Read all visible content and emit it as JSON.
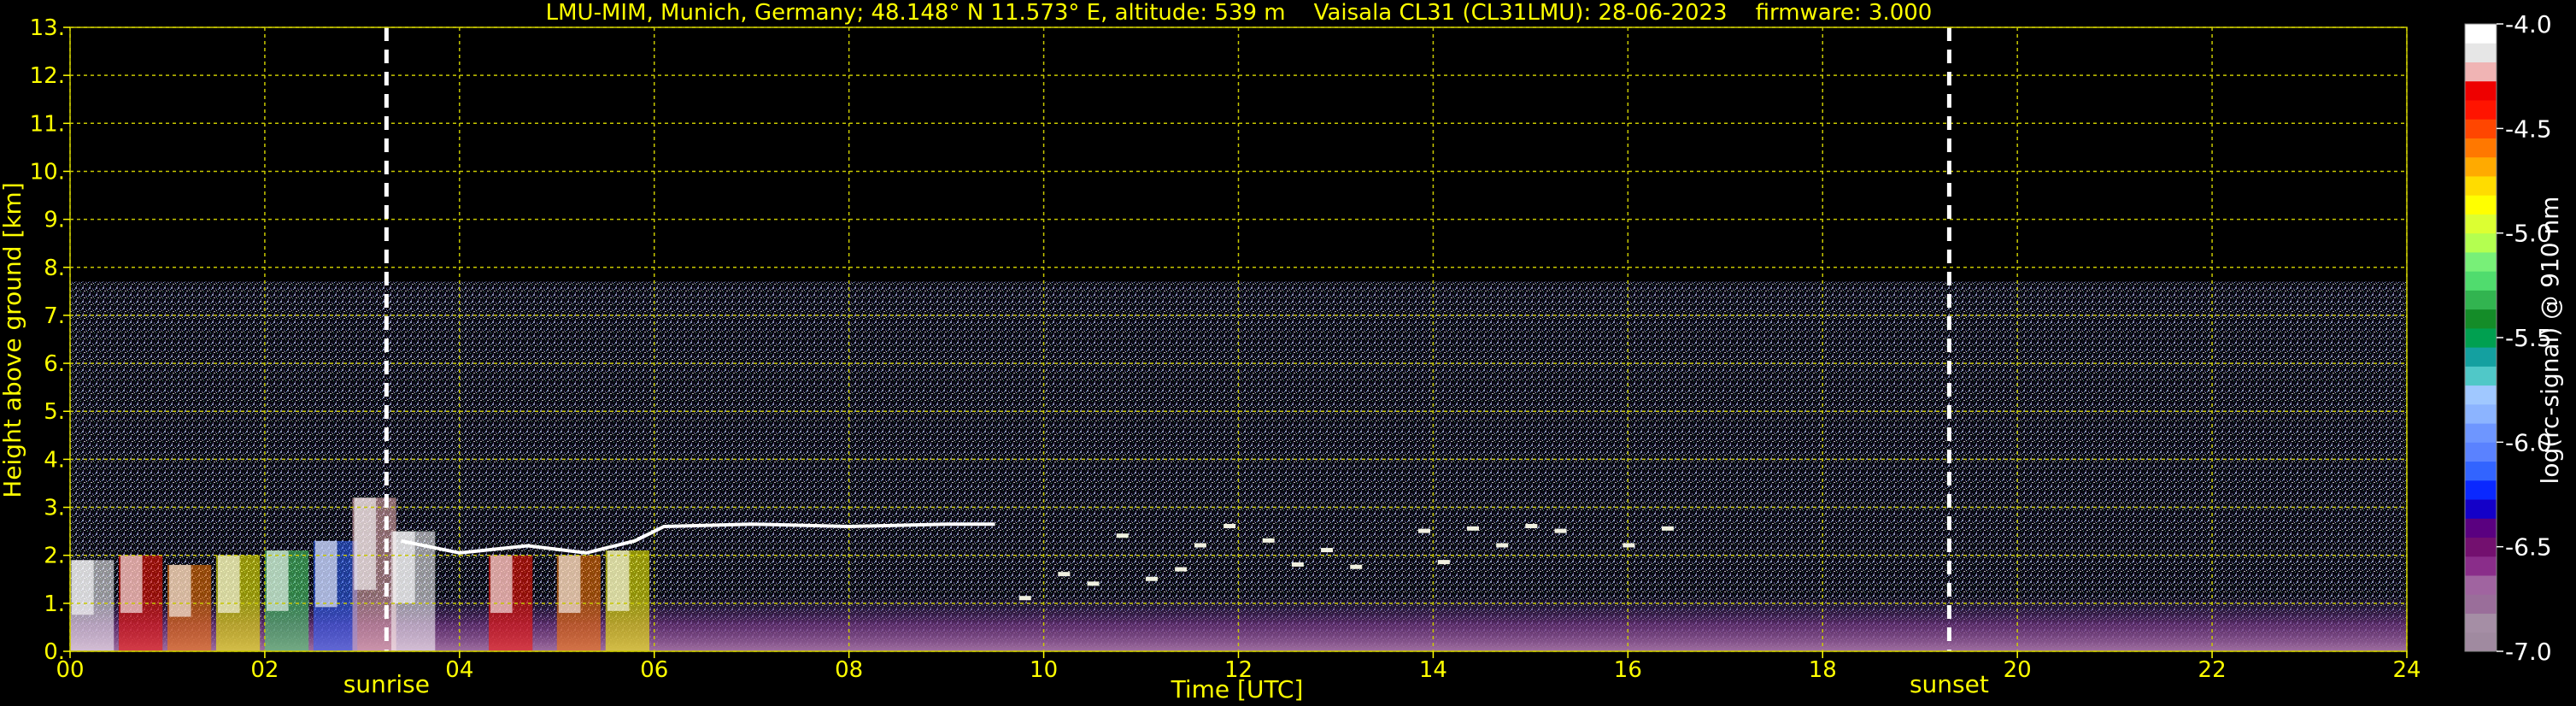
{
  "chart_data": {
    "type": "heatmap",
    "title": "LMU-MIM, Munich, Germany; 48.148° N 11.573° E, altitude: 539 m    Vaisala CL31 (CL31LMU): 28-06-2023    firmware: 3.000",
    "xlabel": "Time [UTC]",
    "ylabel": "Height above ground [km]",
    "xlim": [
      0,
      24
    ],
    "ylim": [
      0,
      13
    ],
    "x_ticks": [
      "00",
      "02",
      "04",
      "06",
      "08",
      "10",
      "12",
      "14",
      "16",
      "18",
      "20",
      "22",
      "24"
    ],
    "y_ticks": [
      "0.",
      "1.",
      "2.",
      "3.",
      "4.",
      "5.",
      "6.",
      "7.",
      "8.",
      "9.",
      "10.",
      "11.",
      "12.",
      "13."
    ],
    "grid": true,
    "data_top_km": 7.7,
    "events": [
      {
        "label": "sunrise",
        "time": 3.25
      },
      {
        "label": "sunset",
        "time": 19.3
      }
    ],
    "colorbar": {
      "label": "log(rc-signal) @ 910 nm",
      "range": [
        -7.0,
        -4.0
      ],
      "ticks": [
        "-7.0",
        "-6.5",
        "-6.0",
        "-5.5",
        "-5.0",
        "-4.5",
        "-4.0"
      ],
      "colors": [
        "#a08aa0",
        "#a58ea5",
        "#9a6e9a",
        "#a064a0",
        "#8a2d8a",
        "#73106f",
        "#5a0080",
        "#1400c8",
        "#0a28ff",
        "#3264ff",
        "#5a82ff",
        "#6e96ff",
        "#8cb4ff",
        "#a0c8ff",
        "#50c8c8",
        "#14a0a0",
        "#00a050",
        "#148c28",
        "#32b450",
        "#50dc6e",
        "#78f078",
        "#b4ff50",
        "#dcff32",
        "#ffff00",
        "#ffdc00",
        "#ffaa00",
        "#ff7800",
        "#ff4600",
        "#ff1400",
        "#ee0000",
        "#f0b4b4",
        "#e6e6e6",
        "#ffffff"
      ]
    },
    "cloud_base_layer": [
      {
        "x": 3.4,
        "y": 2.3
      },
      {
        "x": 4.0,
        "y": 2.05
      },
      {
        "x": 4.7,
        "y": 2.2
      },
      {
        "x": 5.3,
        "y": 2.05
      },
      {
        "x": 5.8,
        "y": 2.3
      },
      {
        "x": 6.1,
        "y": 2.6
      },
      {
        "x": 7.0,
        "y": 2.65
      },
      {
        "x": 8.0,
        "y": 2.6
      },
      {
        "x": 9.0,
        "y": 2.65
      },
      {
        "x": 9.5,
        "y": 2.65
      }
    ],
    "scattered_clouds": [
      {
        "x": 9.8,
        "y": 1.1
      },
      {
        "x": 10.2,
        "y": 1.6
      },
      {
        "x": 10.5,
        "y": 1.4
      },
      {
        "x": 10.8,
        "y": 2.4
      },
      {
        "x": 11.1,
        "y": 1.5
      },
      {
        "x": 11.4,
        "y": 1.7
      },
      {
        "x": 11.6,
        "y": 2.2
      },
      {
        "x": 11.9,
        "y": 2.6
      },
      {
        "x": 12.3,
        "y": 2.3
      },
      {
        "x": 12.6,
        "y": 1.8
      },
      {
        "x": 12.9,
        "y": 2.1
      },
      {
        "x": 13.2,
        "y": 1.75
      },
      {
        "x": 13.9,
        "y": 2.5
      },
      {
        "x": 14.1,
        "y": 1.85
      },
      {
        "x": 14.4,
        "y": 2.55
      },
      {
        "x": 14.7,
        "y": 2.2
      },
      {
        "x": 15.0,
        "y": 2.6
      },
      {
        "x": 15.3,
        "y": 2.5
      },
      {
        "x": 16.0,
        "y": 2.2
      },
      {
        "x": 16.4,
        "y": 2.55
      }
    ],
    "low_clouds_0000_0600": [
      {
        "x": 0.0,
        "y": 1.9
      },
      {
        "x": 0.5,
        "y": 2.0
      },
      {
        "x": 1.0,
        "y": 1.8
      },
      {
        "x": 1.5,
        "y": 2.0
      },
      {
        "x": 2.0,
        "y": 2.1
      },
      {
        "x": 2.5,
        "y": 2.3
      },
      {
        "x": 2.9,
        "y": 3.2
      },
      {
        "x": 3.3,
        "y": 2.5
      },
      {
        "x": 4.3,
        "y": 2.0
      },
      {
        "x": 5.0,
        "y": 2.0
      },
      {
        "x": 5.5,
        "y": 2.1
      }
    ]
  }
}
